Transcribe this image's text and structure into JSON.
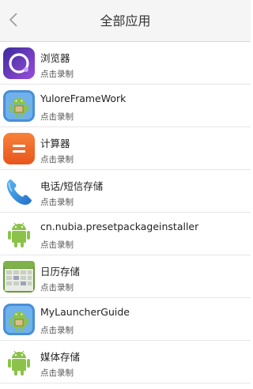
{
  "header": {
    "title": "全部应用",
    "back_icon": "chevron-left-icon"
  },
  "apps": [
    {
      "name": "浏览器",
      "action": "点击录制",
      "icon": "browser-icon"
    },
    {
      "name": "YuloreFrameWork",
      "action": "点击录制",
      "icon": "android-icon"
    },
    {
      "name": "计算器",
      "action": "点击录制",
      "icon": "calculator-icon"
    },
    {
      "name": "电话/短信存储",
      "action": "点击录制",
      "icon": "phone-icon"
    },
    {
      "name": "cn.nubia.presetpackageinstaller",
      "action": "点击录制",
      "icon": "android-icon"
    },
    {
      "name": "日历存储",
      "action": "点击录制",
      "icon": "calendar-icon"
    },
    {
      "name": "MyLauncherGuide",
      "action": "点击录制",
      "icon": "android-icon"
    },
    {
      "name": "媒体存储",
      "action": "点击录制",
      "icon": "android-icon"
    }
  ],
  "colors": {
    "browser": "#6a3fd0",
    "calculator": "#f06a2a",
    "phone": "#2a8ae0",
    "android": "#8bc34a"
  }
}
